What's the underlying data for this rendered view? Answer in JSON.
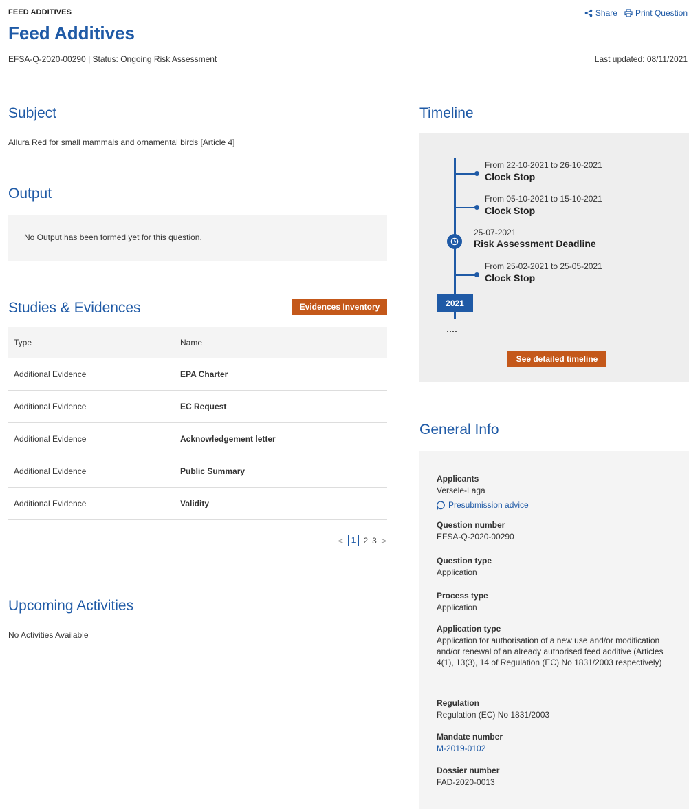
{
  "header": {
    "eyebrow": "FEED ADDITIVES",
    "title": "Feed Additives",
    "meta": "EFSA-Q-2020-00290 | Status: Ongoing Risk Assessment",
    "last_updated": "Last updated: 08/11/2021",
    "share_label": "Share",
    "print_label": "Print Question"
  },
  "subject": {
    "title": "Subject",
    "text": "Allura Red for small mammals and ornamental birds [Article 4]"
  },
  "output": {
    "title": "Output",
    "message": "No Output has been formed yet for this question."
  },
  "studies": {
    "title": "Studies & Evidences",
    "button": "Evidences Inventory",
    "columns": [
      "Type",
      "Name"
    ],
    "rows": [
      {
        "type": "Additional Evidence",
        "name": "EPA Charter"
      },
      {
        "type": "Additional Evidence",
        "name": "EC Request"
      },
      {
        "type": "Additional Evidence",
        "name": "Acknowledgement letter"
      },
      {
        "type": "Additional Evidence",
        "name": "Public Summary"
      },
      {
        "type": "Additional Evidence",
        "name": "Validity"
      }
    ],
    "pager": {
      "prev": "<",
      "pages": [
        "1",
        "2",
        "3"
      ],
      "next": ">"
    }
  },
  "upcoming": {
    "title": "Upcoming Activities",
    "message": "No Activities Available"
  },
  "timeline": {
    "title": "Timeline",
    "events": [
      {
        "date": "From 22-10-2021 to 26-10-2021",
        "label": "Clock Stop"
      },
      {
        "date": "From 05-10-2021 to 15-10-2021",
        "label": "Clock Stop"
      },
      {
        "date": "25-07-2021",
        "label": "Risk Assessment Deadline"
      },
      {
        "date": "From 25-02-2021 to 25-05-2021",
        "label": "Clock Stop"
      }
    ],
    "year": "2021",
    "button": "See detailed timeline",
    "accent": "#1f5aa6"
  },
  "general_info": {
    "title": "General Info",
    "applicants_label": "Applicants",
    "applicants_value": "Versele-Laga",
    "presubmission_link": "Presubmission advice",
    "question_number_label": "Question number",
    "question_number_value": "EFSA-Q-2020-00290",
    "question_type_label": "Question type",
    "question_type_value": "Application",
    "process_type_label": "Process type",
    "process_type_value": "Application",
    "application_type_label": "Application type",
    "application_type_value": "Application for authorisation of a new use and/or modification and/or renewal of an already authorised feed additive (Articles 4(1), 13(3), 14 of Regulation (EC) No 1831/2003 respectively)",
    "regulation_label": "Regulation",
    "regulation_value": "Regulation (EC) No 1831/2003",
    "mandate_number_label": "Mandate number",
    "mandate_number_value": "M-2019-0102",
    "dossier_number_label": "Dossier number",
    "dossier_number_value": "FAD-2020-0013"
  },
  "colors": {
    "brand_blue": "#1f5aa6",
    "accent_orange": "#c4581a"
  }
}
